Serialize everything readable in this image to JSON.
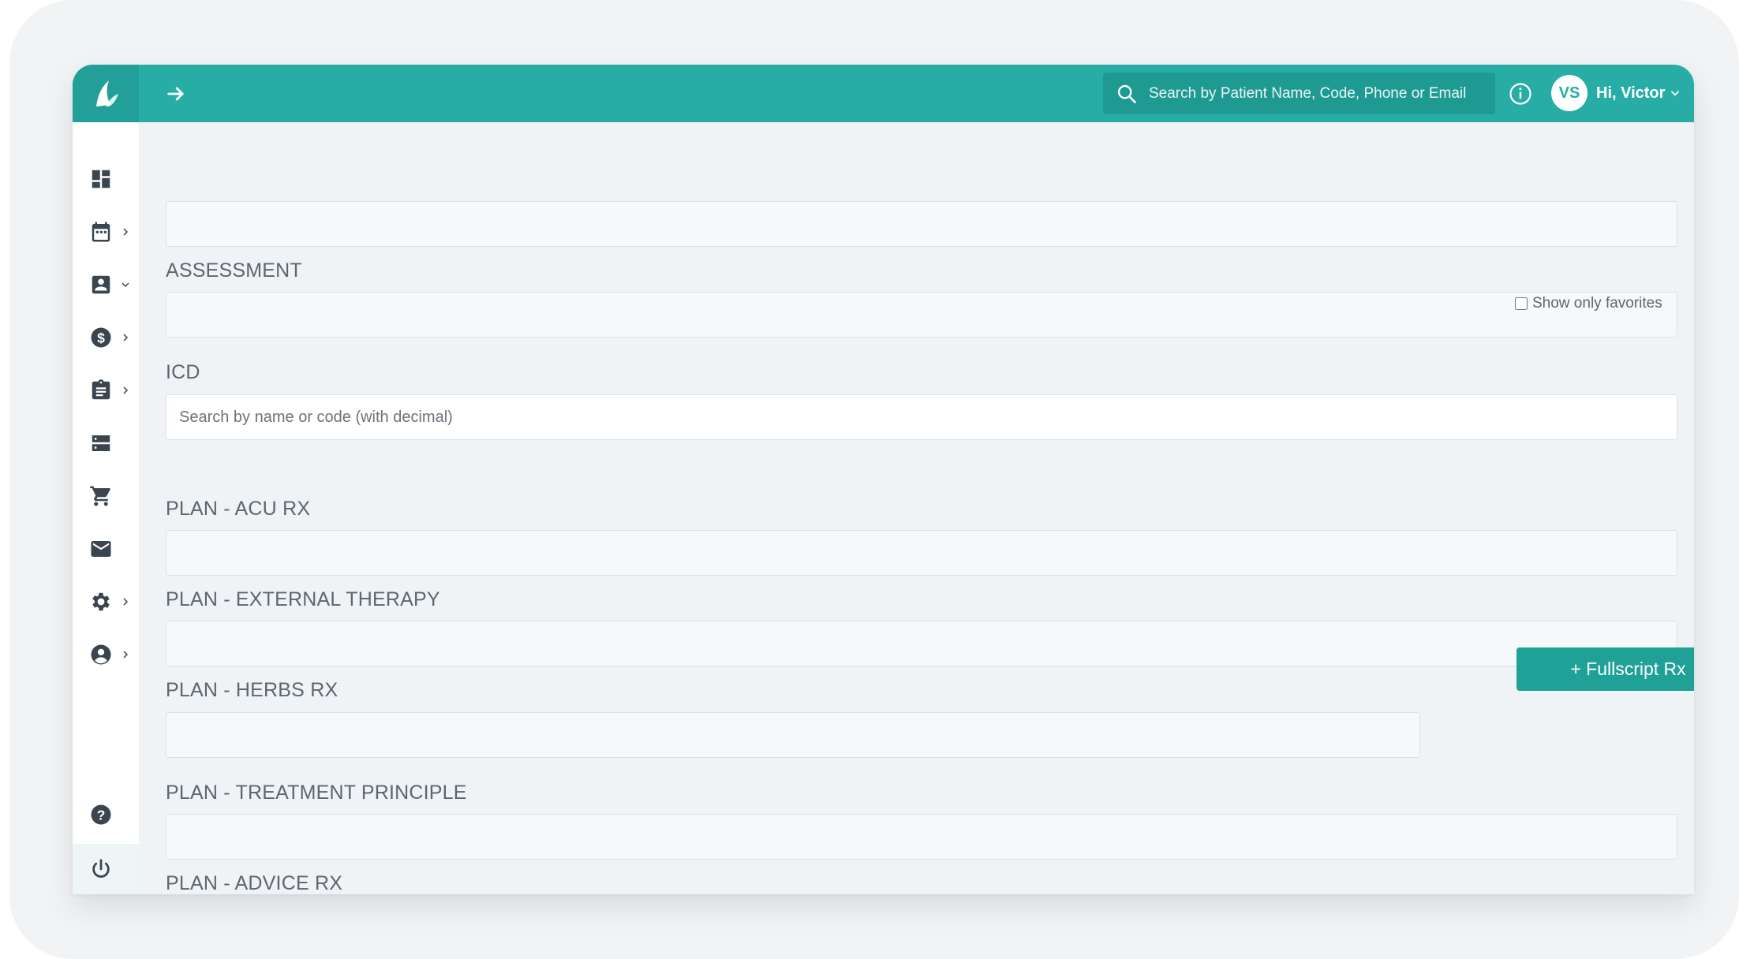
{
  "header": {
    "search_placeholder": "Search by Patient Name, Code, Phone or Email",
    "user_initials": "VS",
    "greeting": "Hi, Victor"
  },
  "sidebar": {
    "items": [
      {
        "icon": "dashboard-icon",
        "has_chevron": false
      },
      {
        "icon": "calendar-icon",
        "has_chevron": true,
        "chevron": "right"
      },
      {
        "icon": "contact-card-icon",
        "has_chevron": true,
        "chevron": "down"
      },
      {
        "icon": "billing-dollar-icon",
        "has_chevron": true,
        "chevron": "right"
      },
      {
        "icon": "clipboard-icon",
        "has_chevron": true,
        "chevron": "right"
      },
      {
        "icon": "storage-icon",
        "has_chevron": false
      },
      {
        "icon": "cart-icon",
        "has_chevron": false
      },
      {
        "icon": "mail-icon",
        "has_chevron": false
      },
      {
        "icon": "gear-icon",
        "has_chevron": true,
        "chevron": "right"
      },
      {
        "icon": "account-icon",
        "has_chevron": true,
        "chevron": "right"
      }
    ],
    "bottom": [
      {
        "icon": "help-icon"
      },
      {
        "icon": "power-icon"
      }
    ]
  },
  "form": {
    "assessment_label": "ASSESSMENT",
    "icd_label": "ICD",
    "icd_placeholder": "Search by name or code (with decimal)",
    "favorites_label": "Show only favorites",
    "acu_label": "PLAN - ACU RX",
    "external_label": "PLAN - EXTERNAL THERAPY",
    "herbs_label": "PLAN - HERBS RX",
    "fullscript_button": "+ Fullscript Rx",
    "treatment_label": "PLAN - TREATMENT PRINCIPLE",
    "advice_label": "PLAN - ADVICE RX"
  },
  "colors": {
    "brand": "#27ada5",
    "brand_dark": "#229f98",
    "button": "#1fa197",
    "icon": "#3a4550"
  }
}
